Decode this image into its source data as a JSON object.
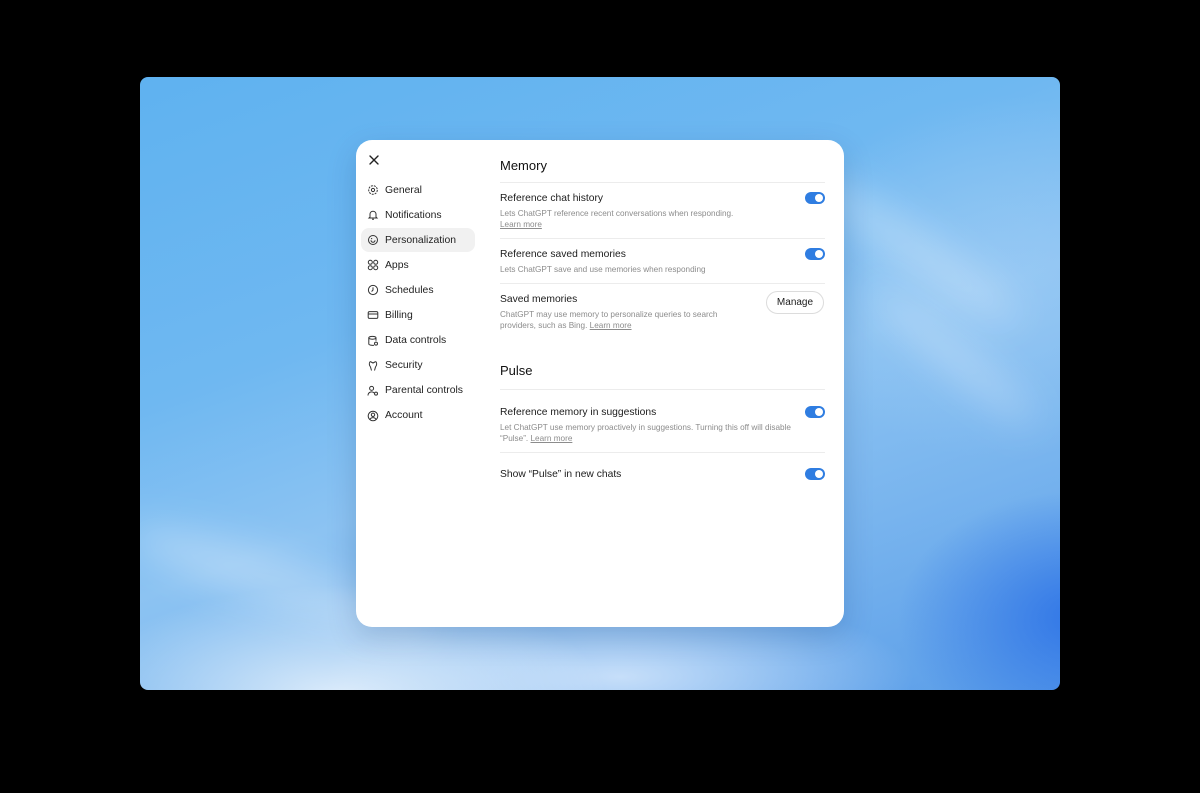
{
  "window": {
    "close_label": "✕"
  },
  "sidebar": {
    "items": [
      {
        "label": "General",
        "icon": "gear-icon",
        "active": false
      },
      {
        "label": "Notifications",
        "icon": "bell-icon",
        "active": false
      },
      {
        "label": "Personalization",
        "icon": "personalization-icon",
        "active": true
      },
      {
        "label": "Apps",
        "icon": "apps-grid-icon",
        "active": false
      },
      {
        "label": "Schedules",
        "icon": "clock-icon",
        "active": false
      },
      {
        "label": "Billing",
        "icon": "credit-card-icon",
        "active": false
      },
      {
        "label": "Data controls",
        "icon": "database-icon",
        "active": false
      },
      {
        "label": "Security",
        "icon": "shield-icon",
        "active": false
      },
      {
        "label": "Parental controls",
        "icon": "parental-icon",
        "active": false
      },
      {
        "label": "Account",
        "icon": "account-icon",
        "active": false
      }
    ]
  },
  "memory": {
    "title": "Memory",
    "reference_chat_history": {
      "title": "Reference chat history",
      "desc": "Lets ChatGPT reference recent conversations when responding.",
      "learn_more": "Learn more",
      "enabled": true
    },
    "reference_saved_memories": {
      "title": "Reference saved memories",
      "desc": "Lets ChatGPT save and use memories when responding",
      "enabled": true
    },
    "saved_memories": {
      "title": "Saved memories",
      "desc": "ChatGPT may use memory to personalize queries to search providers, such as Bing.",
      "learn_more": "Learn more",
      "button": "Manage"
    }
  },
  "pulse": {
    "title": "Pulse",
    "reference_memory_in_suggestions": {
      "title": "Reference memory in suggestions",
      "desc": "Let ChatGPT use memory proactively in suggestions. Turning this off will disable “Pulse”.",
      "learn_more": "Learn more",
      "enabled": true
    },
    "show_pulse": {
      "title": "Show “Pulse” in new chats",
      "enabled": true
    }
  },
  "colors": {
    "accent": "#2f7de1",
    "active_bg": "#f1f1f1"
  }
}
